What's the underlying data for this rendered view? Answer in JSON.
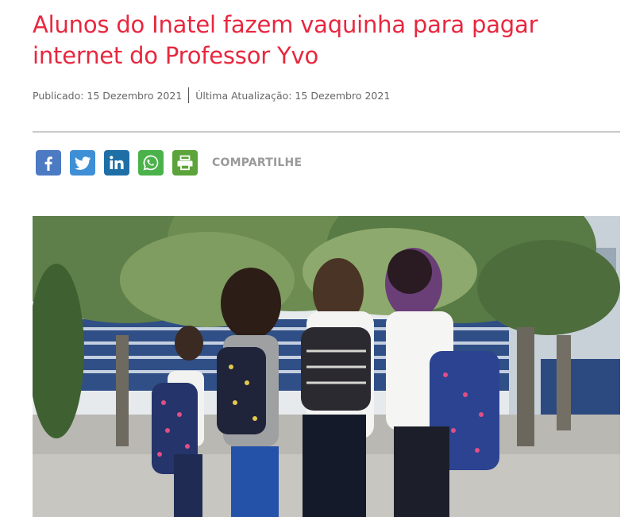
{
  "article": {
    "title": "Alunos do Inatel fazem vaquinha para pagar internet do Professor Yvo",
    "published": "Publicado: 15 Dezembro 2021",
    "updated": "Última Atualização: 15 Dezembro 2021"
  },
  "share": {
    "label": "COMPARTILHE",
    "buttons": [
      {
        "icon": "facebook-icon",
        "color": "#4c7ac3"
      },
      {
        "icon": "twitter-icon",
        "color": "#3e8fd6"
      },
      {
        "icon": "linkedin-icon",
        "color": "#1f6fa7"
      },
      {
        "icon": "whatsapp-icon",
        "color": "#4bb24b"
      },
      {
        "icon": "print-icon",
        "color": "#5ba33a"
      }
    ]
  },
  "colors": {
    "title": "#e8273f",
    "meta_text": "#666666",
    "divider": "#c9c9c9",
    "share_label": "#9a9a9a"
  },
  "image": {
    "subject": "students-walking-with-backpacks-photo"
  }
}
